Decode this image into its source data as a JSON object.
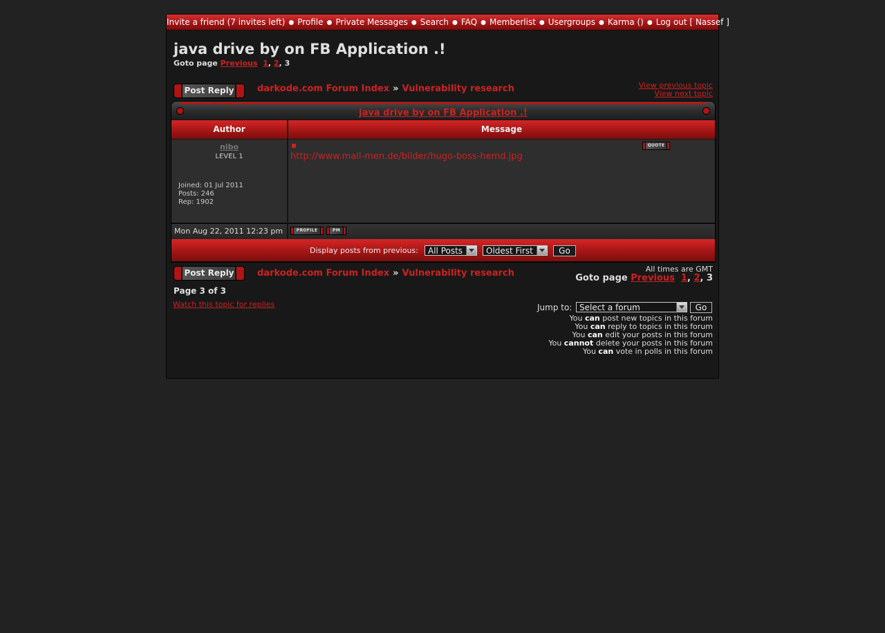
{
  "topnav": {
    "items": [
      "Invite a friend (7 invites left)",
      "Profile",
      "Private Messages",
      "Search",
      "FAQ",
      "Memberlist",
      "Usergroups",
      "Karma ()",
      "Log out [ Nassef ]"
    ],
    "separator": "●"
  },
  "topic": {
    "title": "java drive by on FB Application .!",
    "goto_label": "Goto page",
    "previous_label": "Previous",
    "pages": [
      "1",
      "2"
    ],
    "current_page": "3",
    "view_previous": "View previous topic",
    "view_next": "View next topic"
  },
  "buttons": {
    "post_reply": "Post Reply",
    "quote": "QUOTE",
    "profile": "PROFILE",
    "pm": "PM",
    "go": "Go"
  },
  "breadcrumb": {
    "index": "darkode.com Forum Index",
    "separator": "»",
    "forum": "Vulnerability research"
  },
  "table": {
    "author_header": "Author",
    "message_header": "Message"
  },
  "post": {
    "author": "nibo",
    "level": "LEVEL 1",
    "joined": "Joined: 01 Jul 2011",
    "posts": "Posts: 246",
    "rep": "Rep: 1902",
    "link": "http://www.mail-men.de/bilder/hugo-boss-hemd.jpg",
    "date": "Mon Aug 22, 2011 12:23 pm"
  },
  "display": {
    "label": "Display posts from previous:",
    "posts_selected": "All Posts",
    "order_selected": "Oldest First"
  },
  "footer": {
    "timezone": "All times are GMT",
    "page_of": "Page 3 of 3",
    "watch": "Watch this topic for replies",
    "jump_label": "Jump to:",
    "jump_selected": "Select a forum"
  },
  "permissions": [
    {
      "pre": "You ",
      "bold": "can",
      "post": " post new topics in this forum"
    },
    {
      "pre": "You ",
      "bold": "can",
      "post": " reply to topics in this forum"
    },
    {
      "pre": "You ",
      "bold": "can",
      "post": " edit your posts in this forum"
    },
    {
      "pre": "You ",
      "bold": "cannot",
      "post": " delete your posts in this forum"
    },
    {
      "pre": "You ",
      "bold": "can",
      "post": " vote in polls in this forum"
    }
  ],
  "colors": {
    "accent_red": "#cc2222",
    "bar_red": "#a51616",
    "background": "#222222",
    "panel": "#181818"
  }
}
